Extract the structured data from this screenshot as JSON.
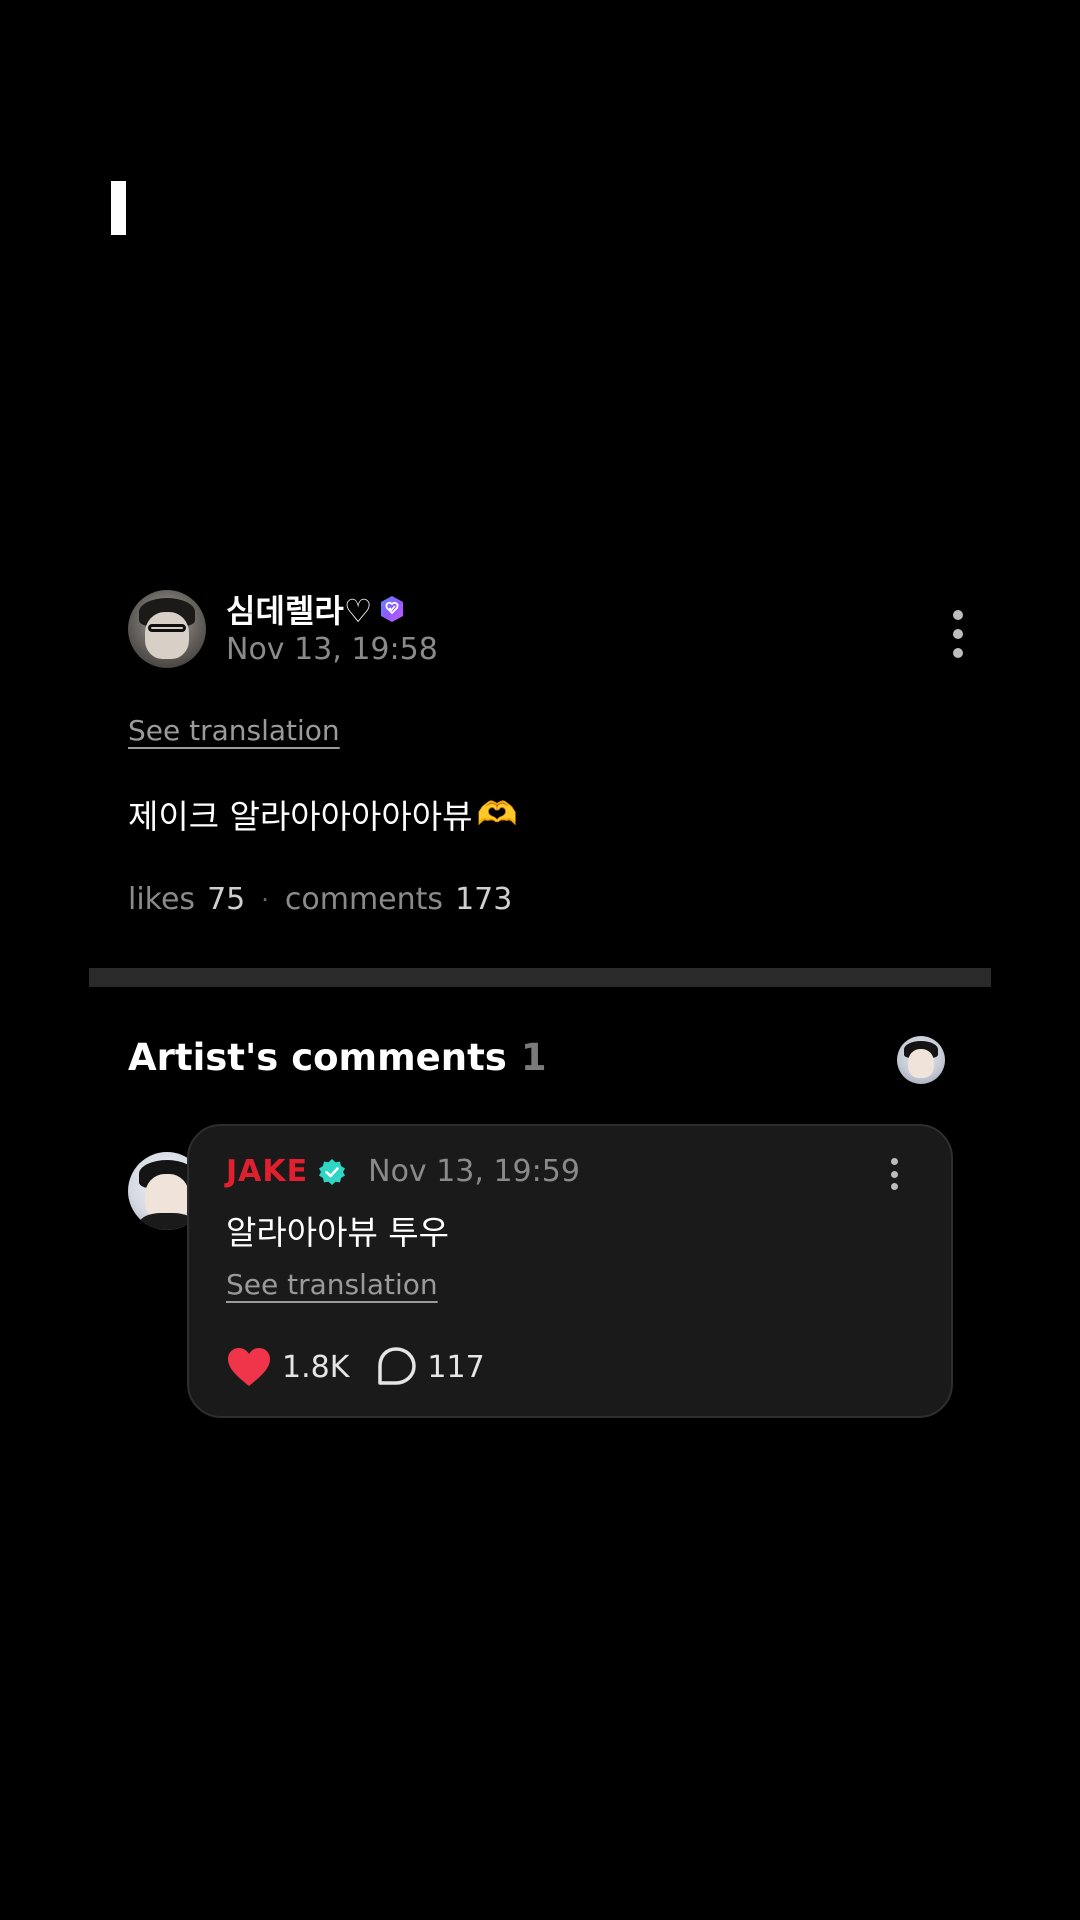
{
  "post": {
    "username": "심데렐라♡",
    "date": "Nov 13, 19:58",
    "see_translation": "See translation",
    "body": "제이크 알라아아아아아뷰",
    "emoji": "🫶",
    "likes_label": "likes",
    "likes_count": "75",
    "separator": "·",
    "comments_label": "comments",
    "comments_count": "173"
  },
  "artist_comments": {
    "heading": "Artist's comments",
    "count": "1",
    "comment": {
      "artist_name": "JAKE",
      "date": "Nov 13, 19:59",
      "text": "알라아아뷰 투우",
      "see_translation": "See translation",
      "likes": "1.8K",
      "replies": "117"
    }
  },
  "colors": {
    "background": "#000000",
    "artist_name": "#e0202e",
    "verified_badge": "#2fd6c4",
    "like_heart": "#f0354a",
    "muted_text": "#8a8a8a"
  },
  "icons": {
    "fan_badge": "verified-fan-badge-icon",
    "artist_badge": "verified-artist-badge-icon",
    "like": "heart-icon",
    "reply": "speech-bubble-icon",
    "more": "more-vertical-icon"
  }
}
